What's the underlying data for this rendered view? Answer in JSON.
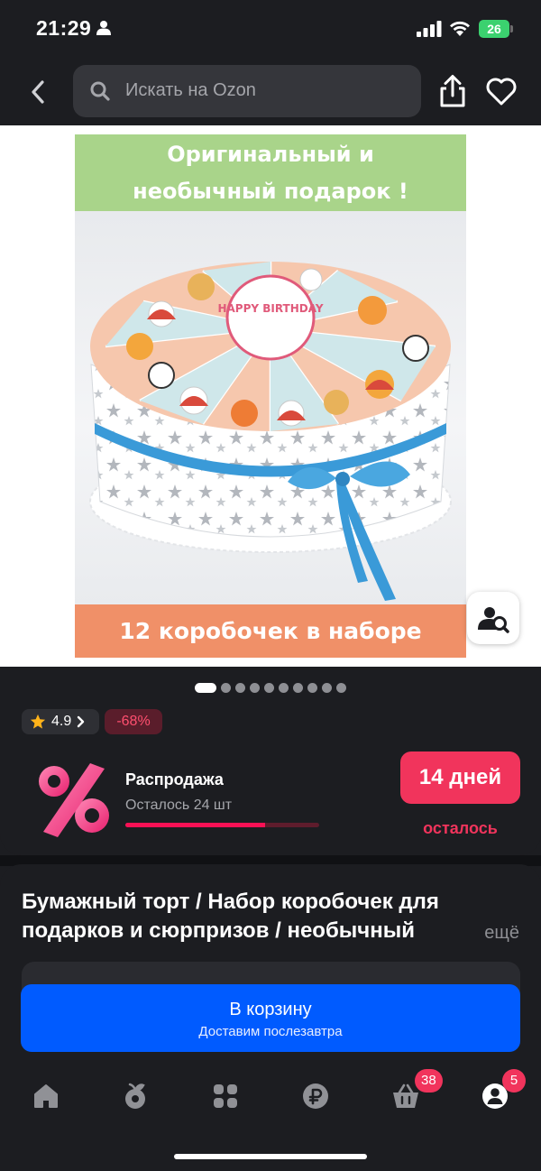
{
  "status": {
    "time": "21:29",
    "battery": "26"
  },
  "header": {
    "search_placeholder": "Искать на Ozon"
  },
  "product_image": {
    "top_text": "Оригинальный и необычный подарок !",
    "bottom_text": "12 коробочек в наборе",
    "topper_text": "HAPPY BIRTHDAY"
  },
  "gallery": {
    "total": 10,
    "active_index": 0
  },
  "rating": {
    "value": "4.9",
    "discount": "-68%"
  },
  "sale": {
    "title": "Распродажа",
    "remaining": "Осталось 24 шт",
    "progress": 0.72,
    "days_left": "14 дней",
    "days_caption": "осталось"
  },
  "product": {
    "title": "Бумажный торт / Набор коробочек для подарков и сюрпризов / необычный",
    "more_label": "ещё"
  },
  "cart": {
    "label": "В корзину",
    "sublabel": "Доставим послезавтра"
  },
  "nav": {
    "cart_badge": "38",
    "profile_badge": "5"
  },
  "colors": {
    "background": "#1c1d21",
    "accent_blue": "#005bff",
    "sale_red": "#f1345c",
    "banner_green": "#a9d48a",
    "banner_orange": "#f09068"
  }
}
